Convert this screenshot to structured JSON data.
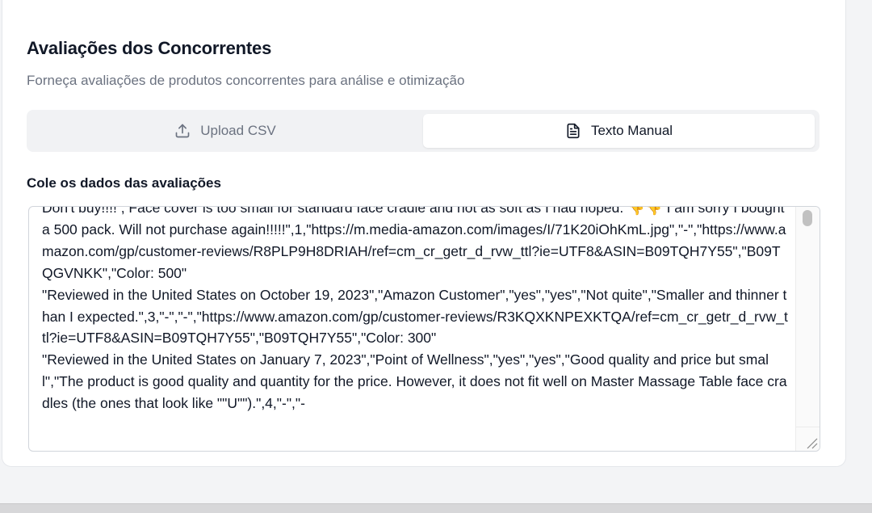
{
  "card": {
    "title": "Avaliações dos Concorrentes",
    "subtitle": "Forneça avaliações de produtos concorrentes para análise e otimização"
  },
  "tabs": [
    {
      "label": "Upload CSV",
      "icon": "upload-icon",
      "active": false
    },
    {
      "label": "Texto Manual",
      "icon": "document-icon",
      "active": true
    }
  ],
  "reviews_field": {
    "label": "Cole os dados das avaliações",
    "value": "Don't buy!!!! , Face cover is too small for standard face cradle and not as soft as I had hoped. 👎👎 I am sorry I bought a 500 pack. Will not purchase again!!!!!\",1,\"https://m.media-amazon.com/images/I/71K20iOhKmL.jpg\",\"-\",\"https://www.amazon.com/gp/customer-reviews/R8PLP9H8DRIAH/ref=cm_cr_getr_d_rvw_ttl?ie=UTF8&ASIN=B09TQH7Y55\",\"B09TQGVNKK\",\"Color: 500\"\n\"Reviewed in the United States on October 19, 2023\",\"Amazon Customer\",\"yes\",\"yes\",\"Not quite\",\"Smaller and thinner than I expected.\",3,\"-\",\"-\",\"https://www.amazon.com/gp/customer-reviews/R3KQXKNPEXKTQA/ref=cm_cr_getr_d_rvw_ttl?ie=UTF8&ASIN=B09TQH7Y55\",\"B09TQH7Y55\",\"Color: 300\"\n\"Reviewed in the United States on January 7, 2023\",\"Point of Wellness\",\"yes\",\"yes\",\"Good quality and price but small\",\"The product is good quality and quantity for the price. However, it does not fit well on Master Massage Table face cradles (the ones that look like \"\"U\"\").\",4,\"-\",\"-"
  },
  "colors": {
    "active_tab_bg": "#ffffff",
    "tab_track_bg": "#f1f2f4",
    "title": "#111827",
    "muted": "#6b7280"
  }
}
